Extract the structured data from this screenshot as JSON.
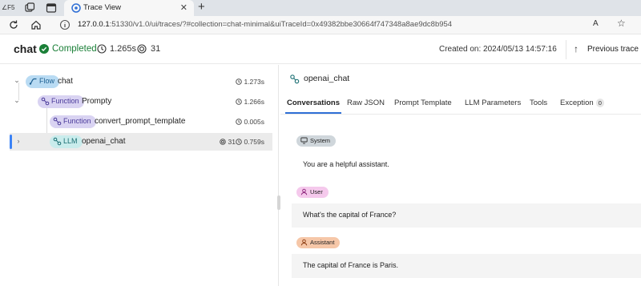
{
  "browser": {
    "edge_label": "∠F5",
    "tab_title": "Trace View",
    "new_tab": "+",
    "close": "✕",
    "url_host": "127.0.0.1",
    "url_rest": ":51330/v1.0/ui/traces/?#collection=chat-minimal&uiTraceId=0x49382bbe30664f747348a8ae9dc8b954",
    "read_aloud": "A",
    "favorite": "☆"
  },
  "header": {
    "app_name": "chat",
    "status": "Completed",
    "duration": "1.265s",
    "tokens": "31",
    "created": "Created on: 2024/05/13 14:57:16",
    "prev_trace": "Previous trace"
  },
  "tree": {
    "nodes": [
      {
        "kind": "Flow",
        "name": "chat",
        "duration": "1.273s",
        "expanded": true
      },
      {
        "kind": "Function",
        "name": "Prompty",
        "duration": "1.266s",
        "expanded": true
      },
      {
        "kind": "Function",
        "name": "convert_prompt_template",
        "duration": "0.005s"
      },
      {
        "kind": "LLM",
        "name": "openai_chat",
        "tokens": "31",
        "duration": "0.759s",
        "selected": true
      }
    ]
  },
  "detail": {
    "title": "openai_chat",
    "tabs": [
      "Conversations",
      "Raw JSON",
      "Prompt Template",
      "LLM Parameters",
      "Tools",
      "Exception"
    ],
    "exception_count": "0",
    "messages": [
      {
        "role": "System",
        "text": "You are a helpful assistant."
      },
      {
        "role": "User",
        "text": "What's the capital of France?"
      },
      {
        "role": "Assistant",
        "text": "The capital of France is Paris."
      }
    ]
  },
  "colors": {
    "completed": "#1a7f37",
    "accent": "#2f6fd6",
    "flow_pill": "#b9dbf3",
    "function_pill": "#d9d3f2",
    "llm_pill": "#c9ecec",
    "system_pill": "#cfd6db",
    "user_pill": "#f5c9ec",
    "assistant_pill": "#f6c7a8"
  }
}
